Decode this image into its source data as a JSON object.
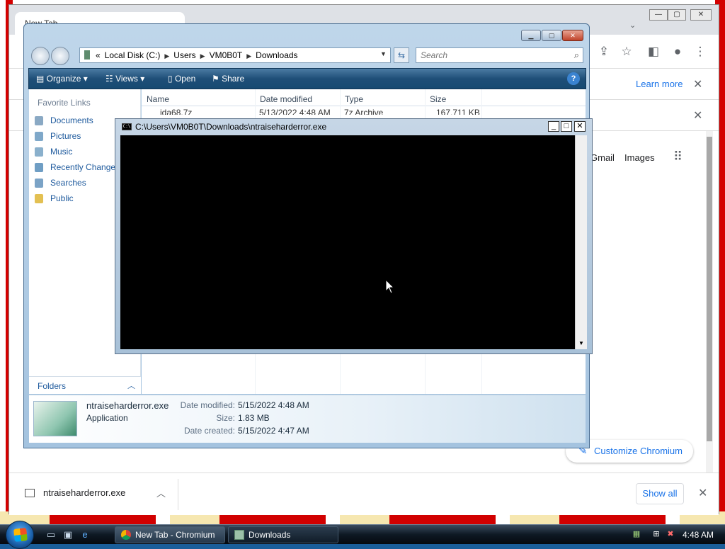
{
  "chromium": {
    "tab_title": "New Tab",
    "window_controls": {
      "minimize": "—",
      "maximize": "▢",
      "close": "✕"
    },
    "infobar": {
      "learn_more": "Learn more"
    },
    "ntp": {
      "gmail": "Gmail",
      "images": "Images",
      "customize": "Customize Chromium"
    },
    "downloads_bar": {
      "file_name": "ntraiseharderror.exe",
      "show_all": "Show all"
    }
  },
  "explorer": {
    "address": {
      "root_chevron": "«",
      "segments": [
        "Local Disk (C:)",
        "Users",
        "VM0B0T",
        "Downloads"
      ]
    },
    "search_placeholder": "Search",
    "command_bar": {
      "organize": "Organize",
      "views": "Views",
      "open": "Open",
      "share": "Share"
    },
    "favorite_links_header": "Favorite Links",
    "favorite_links": [
      "Documents",
      "Pictures",
      "Music",
      "Recently Change",
      "Searches",
      "Public"
    ],
    "folders_label": "Folders",
    "columns": [
      "Name",
      "Date modified",
      "Type",
      "Size"
    ],
    "visible_file": {
      "name": "ida68.7z",
      "date": "5/13/2022 4:48 AM",
      "type": "7z Archive",
      "size": "167,711 KB"
    },
    "details": {
      "file_name": "ntraiseharderror.exe",
      "file_type": "Application",
      "date_modified_label": "Date modified:",
      "date_modified": "5/15/2022 4:48 AM",
      "size_label": "Size:",
      "size": "1.83 MB",
      "date_created_label": "Date created:",
      "date_created": "5/15/2022 4:47 AM"
    }
  },
  "console": {
    "icon_text": "C:\\",
    "title": "C:\\Users\\VM0B0T\\Downloads\\ntraiseharderror.exe"
  },
  "taskbar": {
    "tasks": [
      {
        "label": "New Tab - Chromium"
      },
      {
        "label": "Downloads"
      }
    ],
    "clock": "4:48 AM"
  },
  "colors": {
    "chromium_link": "#1a73e8",
    "explorer_command_bar": "#1f4f78",
    "console_background": "#000000"
  }
}
